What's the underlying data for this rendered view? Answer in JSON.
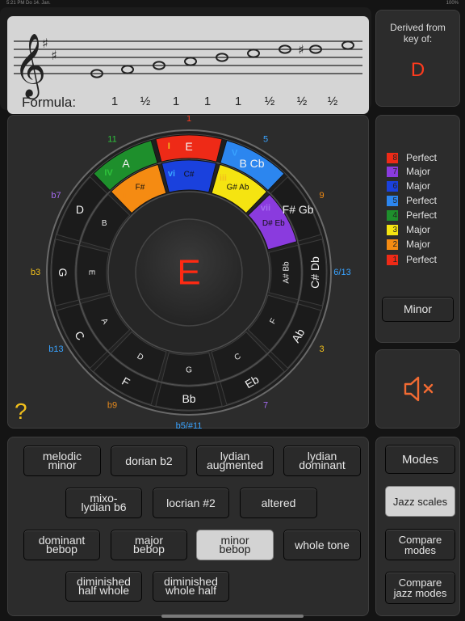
{
  "status_bar": {
    "time": "5:21 PM  Do 14. Jan.",
    "battery": "100%"
  },
  "staff": {
    "key_signature": "two sharps",
    "formula_label": "Formula:",
    "formula": [
      "1",
      "½",
      "1",
      "1",
      "1",
      "½",
      "½",
      "½"
    ]
  },
  "derived": {
    "title_line1": "Derived from",
    "title_line2": "key of:",
    "key": "D"
  },
  "wheel": {
    "center": "E",
    "top_colored": [
      {
        "degree": "I",
        "note": "E",
        "color": "#ee2a17",
        "num": "1",
        "numcolor": "#ff3b1e"
      },
      {
        "degree": "V",
        "note": "B\nCb",
        "color": "#2c86ef",
        "num": "5",
        "numcolor": "#39a3ff"
      },
      {
        "degree": "IV",
        "note": "A",
        "color": "#1e8f2c",
        "num": "11",
        "numcolor": "#2fc33c"
      }
    ],
    "inner_colored": [
      {
        "degree": "vi",
        "note": "C#",
        "color": "#1a41dd"
      },
      {
        "degree": "iii",
        "note": "G#\nAb",
        "color": "#f5e411"
      },
      {
        "degree": "ii",
        "note": "F#",
        "color": "#f58b12"
      },
      {
        "degree": "vii",
        "note": "D#\nEb",
        "color": "#8a3bde"
      }
    ],
    "outer_notes": [
      "E",
      "B Cb",
      "F# Gb",
      "C# Db",
      "Ab",
      "Eb",
      "Bb",
      "F",
      "C",
      "G",
      "D",
      "A"
    ],
    "inner_notes": [
      "C#",
      "G# Ab",
      "D# Eb",
      "A# Bb",
      "F",
      "C",
      "G",
      "D",
      "A",
      "E",
      "B",
      "F#"
    ],
    "interval_labels": [
      {
        "text": "1",
        "color": "#ff3b1e"
      },
      {
        "text": "5",
        "color": "#39a3ff"
      },
      {
        "text": "9",
        "color": "#f58b12"
      },
      {
        "text": "6/13",
        "color": "#39a3ff"
      },
      {
        "text": "3",
        "color": "#f2c01c"
      },
      {
        "text": "7",
        "color": "#a56bf0"
      },
      {
        "text": "b5/#11",
        "color": "#39a3ff"
      },
      {
        "text": "b9",
        "color": "#e58a1e"
      },
      {
        "text": "b13",
        "color": "#39a3ff"
      },
      {
        "text": "b3",
        "color": "#f2c01c"
      },
      {
        "text": "b7",
        "color": "#a56bf0"
      },
      {
        "text": "11",
        "color": "#2fc33c"
      }
    ]
  },
  "legend": [
    {
      "num": "8",
      "label": "Perfect",
      "color": "#ee2a17"
    },
    {
      "num": "7",
      "label": "Major",
      "color": "#8a3bde"
    },
    {
      "num": "6",
      "label": "Major",
      "color": "#1a41dd"
    },
    {
      "num": "5",
      "label": "Perfect",
      "color": "#2c86ef"
    },
    {
      "num": "4",
      "label": "Perfect",
      "color": "#1e8f2c"
    },
    {
      "num": "3",
      "label": "Major",
      "color": "#f5e411"
    },
    {
      "num": "2",
      "label": "Major",
      "color": "#f58b12"
    },
    {
      "num": "1",
      "label": "Perfect",
      "color": "#ee2a17"
    }
  ],
  "minor_button": "Minor",
  "mute_icon": "speaker-muted-icon",
  "help": "?",
  "scales": [
    {
      "l1": "melodic",
      "l2": "minor",
      "selected": false
    },
    {
      "l1": "dorian b2",
      "l2": "",
      "selected": false
    },
    {
      "l1": "lydian",
      "l2": "augmented",
      "selected": false
    },
    {
      "l1": "lydian",
      "l2": "dominant",
      "selected": false
    },
    {
      "l1": "mixo-",
      "l2": "lydian b6",
      "selected": false
    },
    {
      "l1": "locrian #2",
      "l2": "",
      "selected": false
    },
    {
      "l1": "altered",
      "l2": "",
      "selected": false
    },
    {
      "l1": "dominant",
      "l2": "bebop",
      "selected": false
    },
    {
      "l1": "major",
      "l2": "bebop",
      "selected": false
    },
    {
      "l1": "minor",
      "l2": "bebop",
      "selected": true
    },
    {
      "l1": "whole tone",
      "l2": "",
      "selected": false
    },
    {
      "l1": "diminished",
      "l2": "half whole",
      "selected": false
    },
    {
      "l1": "diminished",
      "l2": "whole half",
      "selected": false
    }
  ],
  "right_menu": {
    "modes": "Modes",
    "jazz_scales": "Jazz scales",
    "compare_modes_1": "Compare",
    "compare_modes_2": "modes",
    "compare_jazz_1": "Compare",
    "compare_jazz_2": "jazz modes"
  }
}
